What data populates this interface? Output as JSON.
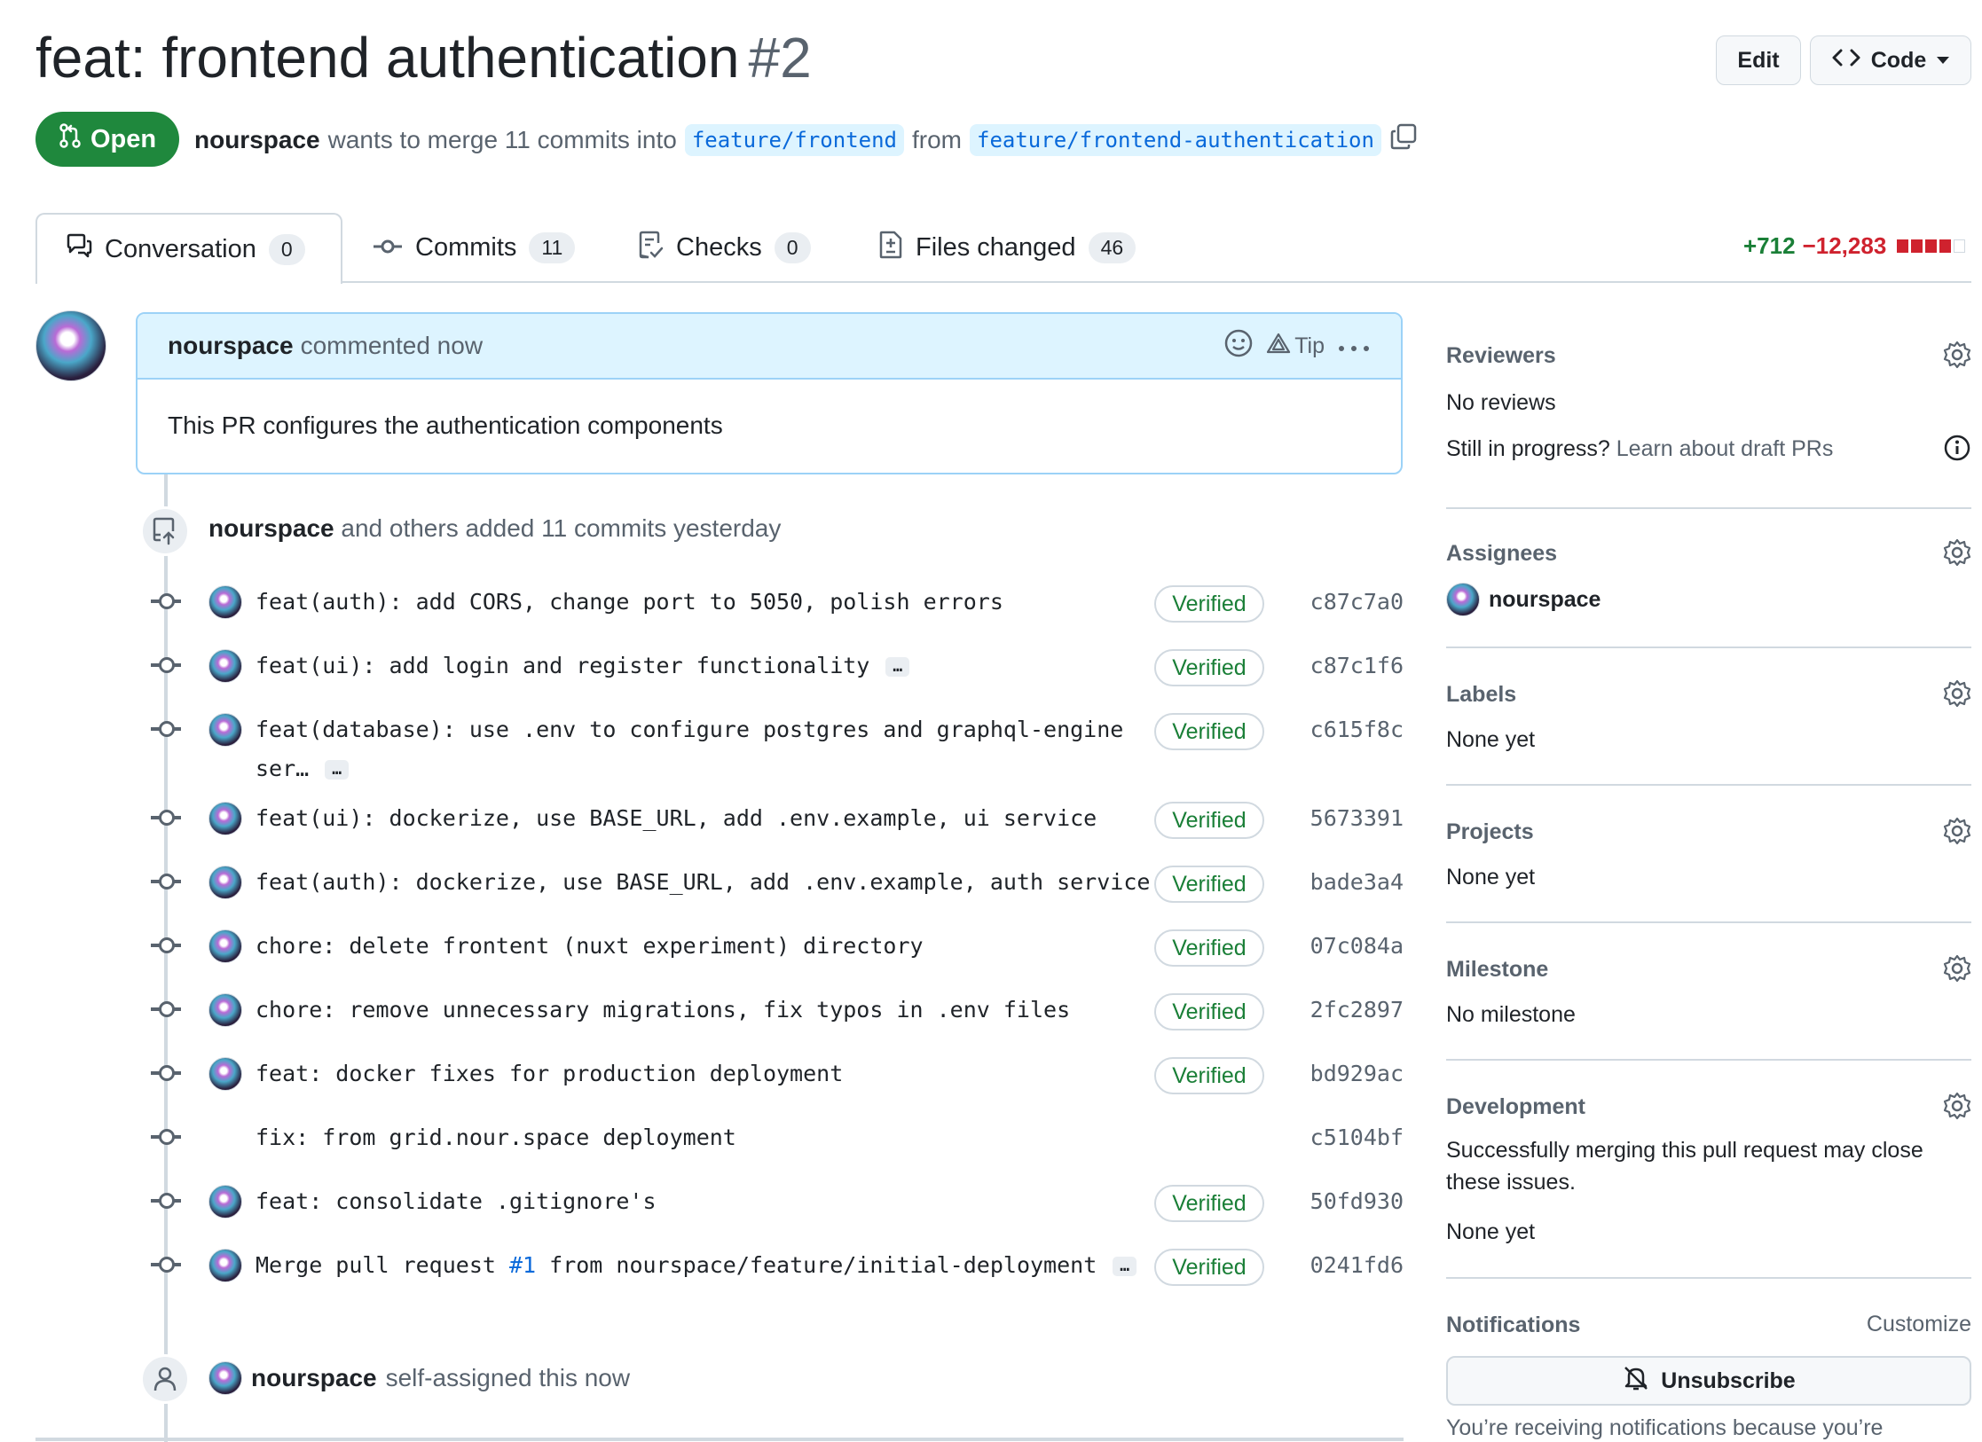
{
  "pr": {
    "title": "feat: frontend authentication",
    "number": "#2",
    "state": "Open",
    "author": "nourspace",
    "merge_text": "wants to merge 11 commits into",
    "base_branch": "feature/frontend",
    "from_text": "from",
    "head_branch": "feature/frontend-authentication"
  },
  "header_buttons": {
    "edit": "Edit",
    "code": "Code"
  },
  "tabs": [
    {
      "label": "Conversation",
      "count": "0"
    },
    {
      "label": "Commits",
      "count": "11"
    },
    {
      "label": "Checks",
      "count": "0"
    },
    {
      "label": "Files changed",
      "count": "46"
    }
  ],
  "diffstat": {
    "additions": "+712",
    "deletions": "−12,283"
  },
  "comment": {
    "author": "nourspace",
    "action": "commented now",
    "tip": "Tip",
    "body": "This PR configures the authentication components"
  },
  "commits_event": {
    "author": "nourspace",
    "text": "and others added 11 commits yesterday"
  },
  "commits": [
    {
      "message": "feat(auth): add CORS, change port to 5050, polish errors",
      "verified": "Verified",
      "sha": "c87c7a0"
    },
    {
      "message": "feat(ui): add login and register functionality",
      "verified": "Verified",
      "sha": "c87c1f6"
    },
    {
      "message": "feat(database): use .env to configure postgres and graphql-engine",
      "message_cont": "ser…",
      "verified": "Verified",
      "sha": "c615f8c"
    },
    {
      "message": "feat(ui): dockerize, use BASE_URL, add .env.example, ui service",
      "verified": "Verified",
      "sha": "5673391"
    },
    {
      "message": "feat(auth): dockerize, use BASE_URL, add .env.example, auth service",
      "verified": "Verified",
      "sha": "bade3a4"
    },
    {
      "message": "chore: delete frontent (nuxt experiment) directory",
      "verified": "Verified",
      "sha": "07c084a"
    },
    {
      "message": "chore: remove unnecessary migrations, fix typos in .env files",
      "verified": "Verified",
      "sha": "2fc2897"
    },
    {
      "message": "feat: docker fixes for production deployment",
      "verified": "Verified",
      "sha": "bd929ac"
    },
    {
      "message": "fix: from grid.nour.space deployment",
      "sha": "c5104bf"
    },
    {
      "message": "feat: consolidate .gitignore's",
      "verified": "Verified",
      "sha": "50fd930"
    },
    {
      "message_pre": "Merge pull request ",
      "message_link": "#1",
      "message_post": " from nourspace/feature/initial-deployment",
      "verified": "Verified",
      "sha": "0241fd6"
    }
  ],
  "ellipsis": "…",
  "assign_event": {
    "author": "nourspace",
    "text": "self-assigned this now"
  },
  "sidebar": {
    "reviewers": {
      "title": "Reviewers",
      "value": "No reviews",
      "draft_q": "Still in progress?",
      "draft_link": "Learn about draft PRs"
    },
    "assignees": {
      "title": "Assignees",
      "value": "nourspace"
    },
    "labels": {
      "title": "Labels",
      "value": "None yet"
    },
    "projects": {
      "title": "Projects",
      "value": "None yet"
    },
    "milestone": {
      "title": "Milestone",
      "value": "No milestone"
    },
    "development": {
      "title": "Development",
      "desc1": "Successfully merging this pull request may close",
      "desc2": "these issues.",
      "value": "None yet"
    },
    "notifications": {
      "title": "Notifications",
      "customize": "Customize",
      "button": "Unsubscribe",
      "note": "You’re receiving notifications because you’re"
    }
  },
  "colors": {
    "open": "#1f883d",
    "link": "#0969da",
    "verified": "#1a7f37",
    "deletions": "#cf222e"
  }
}
